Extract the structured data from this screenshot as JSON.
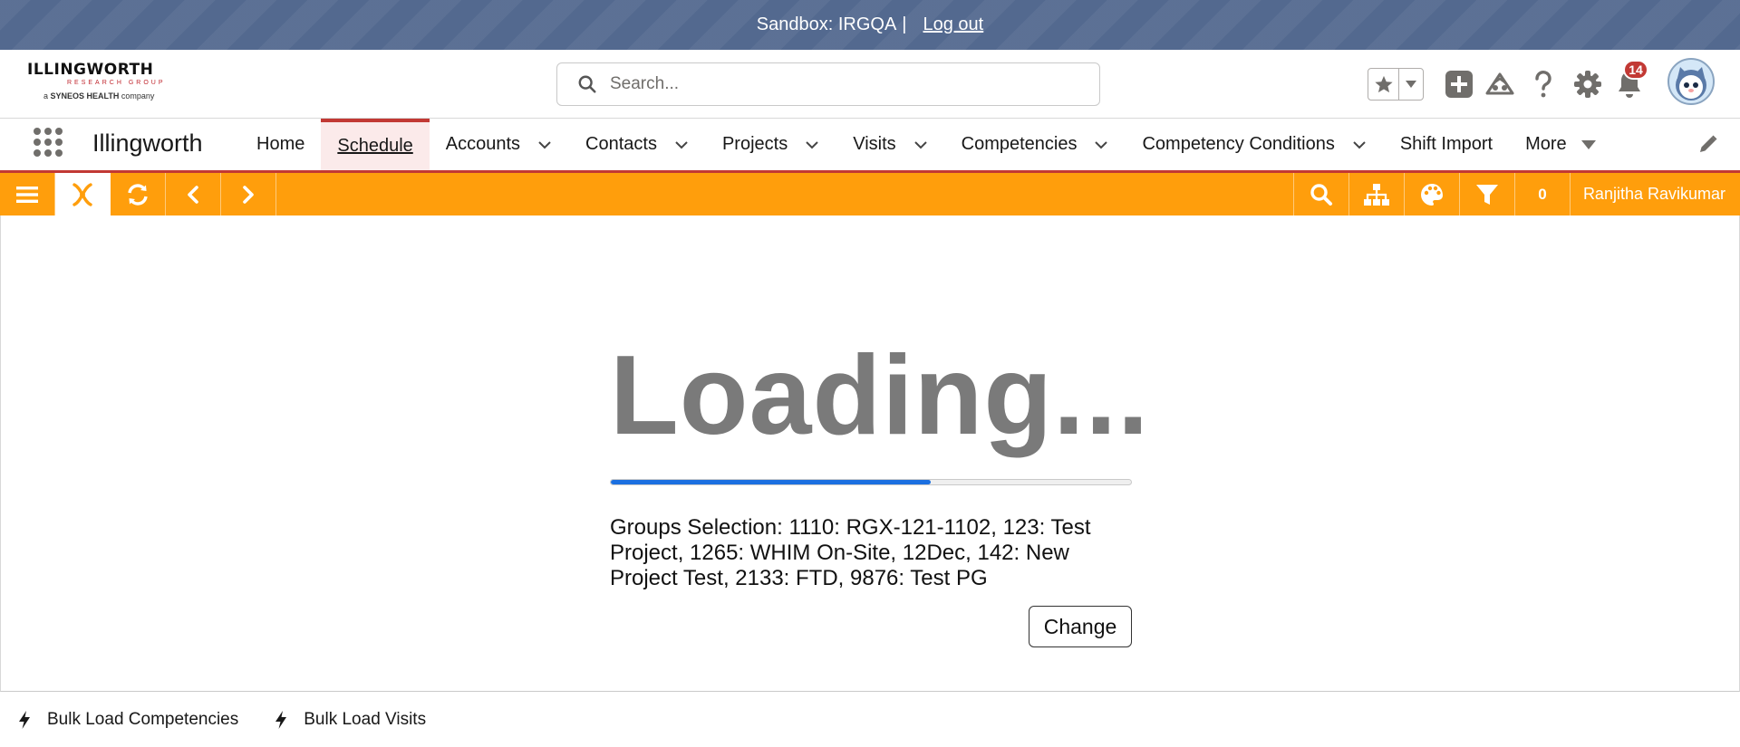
{
  "sandbox": {
    "text": "Sandbox: IRGQA",
    "separator": "|",
    "logout": "Log out"
  },
  "logo": {
    "line1": "ILLINGWORTH",
    "line2": "RESEARCH GROUP",
    "line3_prefix": "a",
    "line3_brand": "SYNEOS HEALTH",
    "line3_suffix": "company"
  },
  "search": {
    "placeholder": "Search..."
  },
  "notifications": {
    "count": "14"
  },
  "nav": {
    "app_name": "Illingworth",
    "items": [
      {
        "label": "Home",
        "has_menu": false
      },
      {
        "label": "Schedule",
        "has_menu": false,
        "active": true
      },
      {
        "label": "Accounts",
        "has_menu": true
      },
      {
        "label": "Contacts",
        "has_menu": true
      },
      {
        "label": "Projects",
        "has_menu": true
      },
      {
        "label": "Visits",
        "has_menu": true
      },
      {
        "label": "Competencies",
        "has_menu": true
      },
      {
        "label": "Competency Conditions",
        "has_menu": true
      },
      {
        "label": "Shift Import",
        "has_menu": false
      },
      {
        "label": "More",
        "has_menu": "triangle"
      }
    ]
  },
  "toolbar": {
    "count": "0",
    "user": "Ranjitha Ravikumar"
  },
  "loading": {
    "title": "Loading...",
    "progress_fraction": 0.615,
    "groups_text": "Groups Selection: 1110: RGX-121-1102, 123: Test Project, 1265: WHIM On-Site, 12Dec, 142: New Project Test, 2133: FTD, 9876: Test PG",
    "change_label": "Change"
  },
  "utility": {
    "items": [
      "Bulk Load Competencies",
      "Bulk Load Visits"
    ]
  },
  "colors": {
    "sandbox": "#53698f",
    "toolbar": "#ff9e0c",
    "progress": "#1b6fe0",
    "accent_red": "#c23934"
  }
}
